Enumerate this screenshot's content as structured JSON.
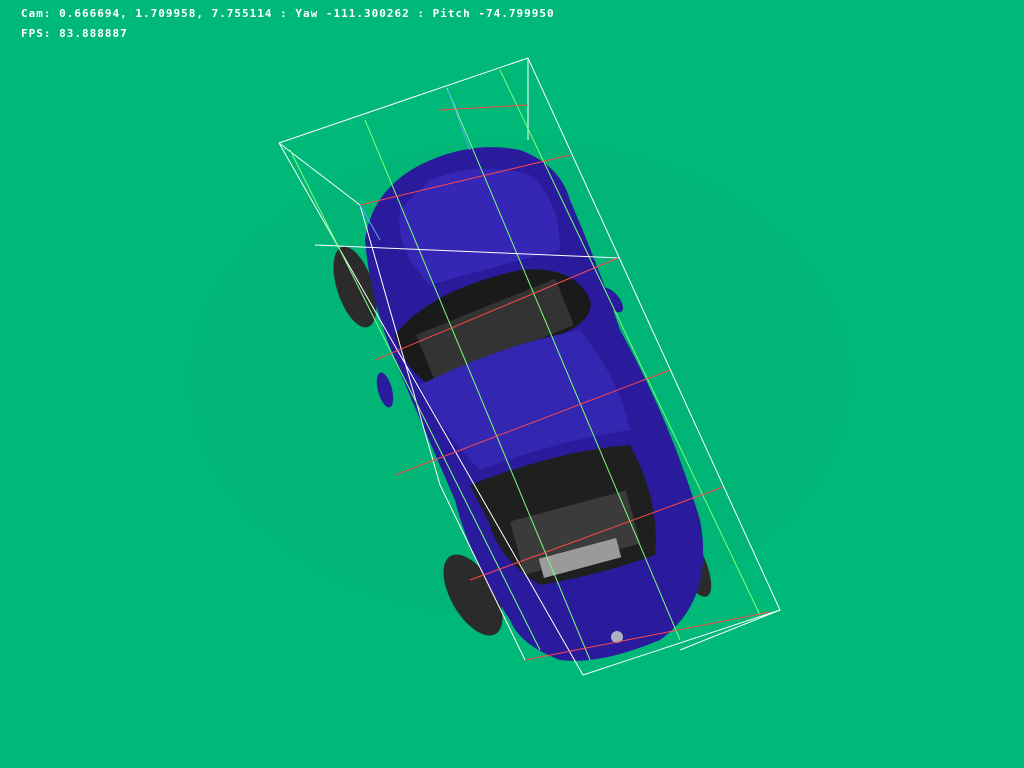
{
  "scene": {
    "background_color": "#00b878",
    "car_body_color": "#2a1a9c",
    "cage_line_colors": [
      "#ffffff",
      "#7cff7c",
      "#ff4a4a",
      "#5aa8ff"
    ]
  },
  "hud": {
    "cam_text": "Cam: 0.666694, 1.709958, 7.755114 : Yaw -111.300262 : Pitch -74.799950",
    "fps_text": "FPS: 83.888887"
  }
}
